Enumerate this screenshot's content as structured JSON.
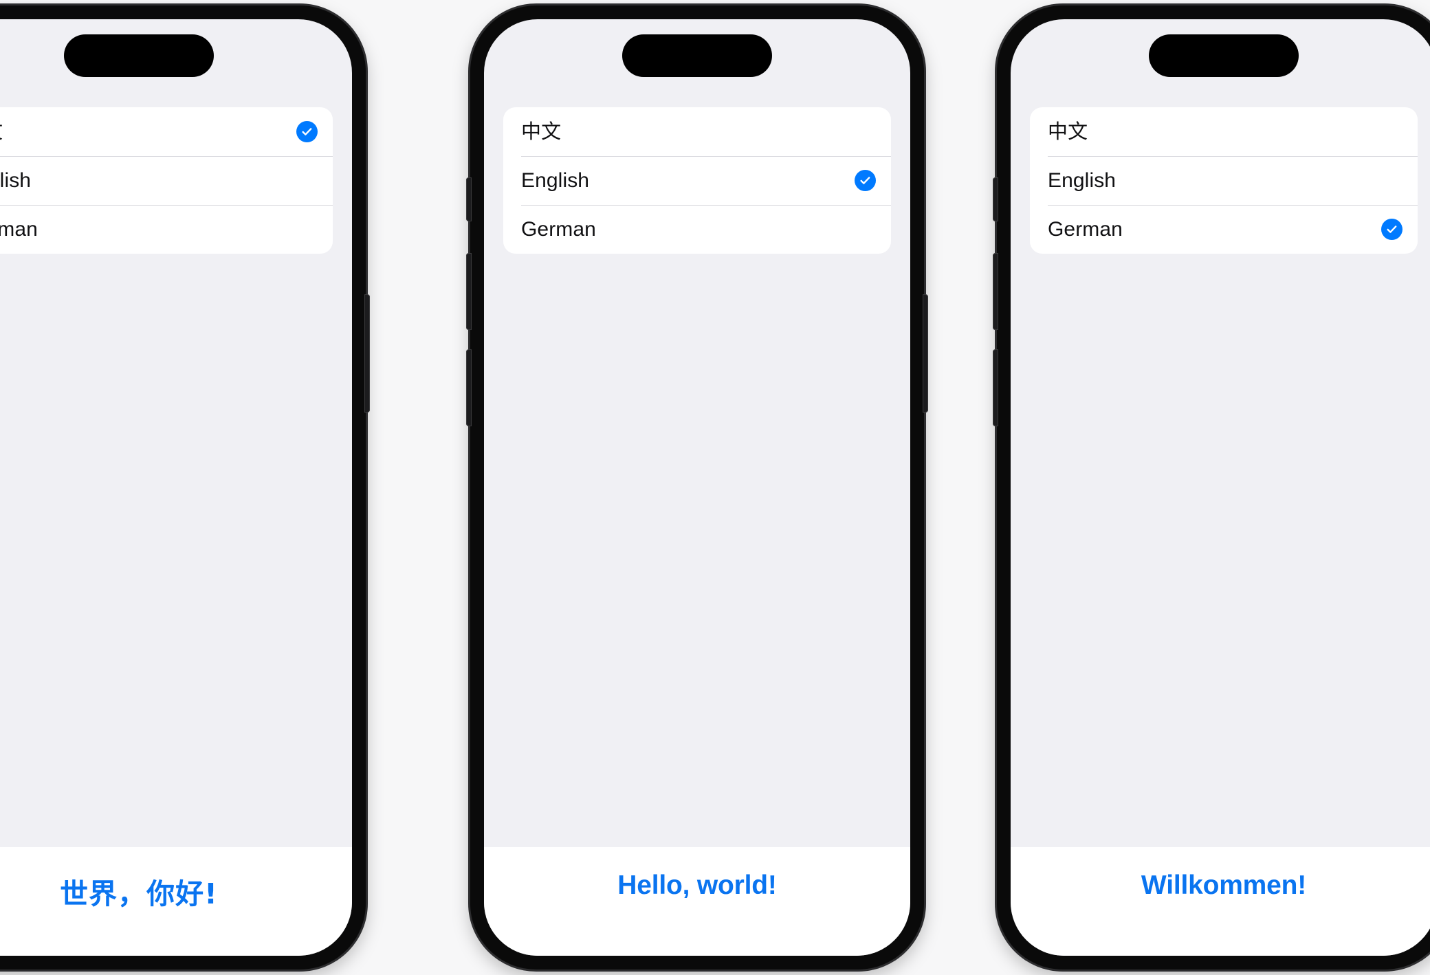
{
  "page": {
    "background_color": "#f7f7f8",
    "screen_background_color": "#f0f0f4",
    "accent_color": "#007aff",
    "greeting_color": "#0a74f0"
  },
  "phones": [
    {
      "id": "phone-chinese",
      "selected_language": "中文",
      "language_list": [
        {
          "label": "中文",
          "script": "cjk",
          "selected": true
        },
        {
          "label": "English",
          "script": "latin",
          "selected": false
        },
        {
          "label": "German",
          "script": "latin",
          "selected": false
        }
      ],
      "greeting": "世界，你好!",
      "greeting_script": "cjk"
    },
    {
      "id": "phone-english",
      "selected_language": "English",
      "language_list": [
        {
          "label": "中文",
          "script": "cjk",
          "selected": false
        },
        {
          "label": "English",
          "script": "latin",
          "selected": true
        },
        {
          "label": "German",
          "script": "latin",
          "selected": false
        }
      ],
      "greeting": "Hello, world!",
      "greeting_script": "latin"
    },
    {
      "id": "phone-german",
      "selected_language": "German",
      "language_list": [
        {
          "label": "中文",
          "script": "cjk",
          "selected": false
        },
        {
          "label": "English",
          "script": "latin",
          "selected": false
        },
        {
          "label": "German",
          "script": "latin",
          "selected": true
        }
      ],
      "greeting": "Willkommen!",
      "greeting_script": "latin"
    }
  ],
  "icons": {
    "checkmark": "checkmark-circle-icon",
    "dynamic_island": "dynamic-island"
  }
}
